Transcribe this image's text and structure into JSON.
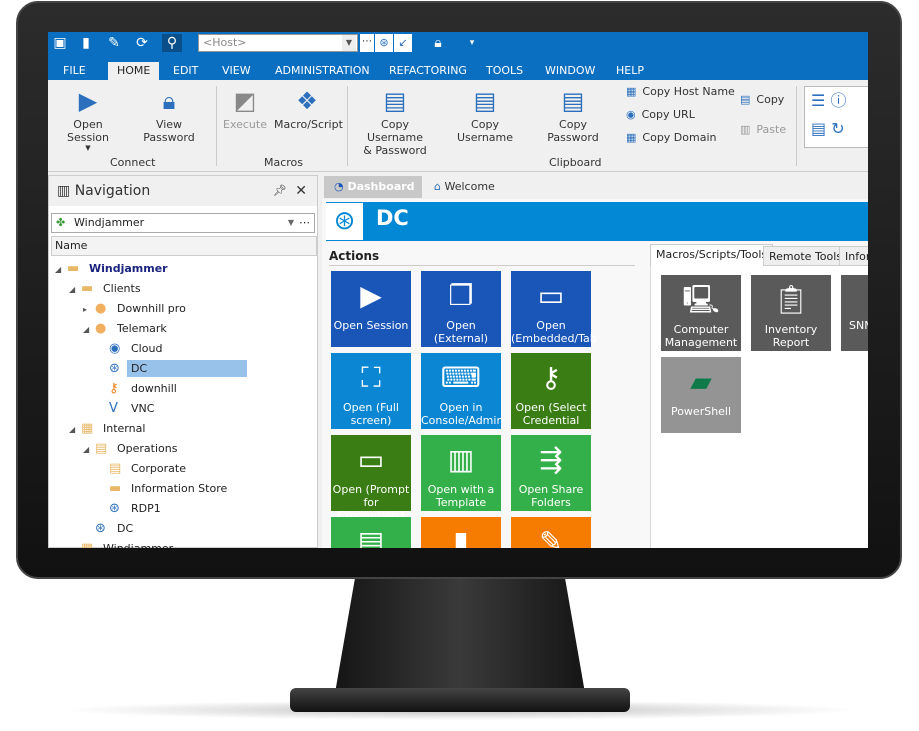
{
  "quick_toolbar": {
    "host_placeholder": "<Host>",
    "icons": [
      "monitor-icon",
      "document-icon",
      "pencil-icon",
      "refresh-icon",
      "search-icon",
      "rdp-icon",
      "arrow-icon",
      "lock-icon"
    ]
  },
  "menu_tabs": [
    "FILE",
    "HOME",
    "EDIT",
    "VIEW",
    "ADMINISTRATION",
    "REFACTORING",
    "TOOLS",
    "WINDOW",
    "HELP"
  ],
  "active_tab": "HOME",
  "ribbon": {
    "connect": {
      "label": "Connect",
      "open_session": "Open Session",
      "view_password": "View Password"
    },
    "macros": {
      "label": "Macros",
      "execute": "Execute",
      "macro_script": "Macro/Script"
    },
    "clipboard": {
      "label": "Clipboard",
      "copy_user_pass_1": "Copy Username",
      "copy_user_pass_2": "& Password",
      "copy_username": "Copy Username",
      "copy_password": "Copy Password",
      "copy_host_name": "Copy Host Name",
      "copy_url": "Copy URL",
      "copy_domain": "Copy Domain",
      "copy": "Copy",
      "paste": "Paste"
    }
  },
  "navigation": {
    "title": "Navigation",
    "vault": "Windjammer",
    "column": "Name",
    "tree": [
      {
        "label": "Windjammer",
        "icon": "folder-icon",
        "bold": true
      },
      {
        "label": "Clients",
        "icon": "folder-icon"
      },
      {
        "label": "Downhill pro",
        "icon": "user-icon"
      },
      {
        "label": "Telemark",
        "icon": "user-icon"
      },
      {
        "label": "Cloud",
        "icon": "globe-icon"
      },
      {
        "label": "DC",
        "icon": "rdp-icon",
        "selected": true
      },
      {
        "label": "downhill",
        "icon": "key-icon"
      },
      {
        "label": "VNC",
        "icon": "vnc-icon"
      },
      {
        "label": "Internal",
        "icon": "building-icon"
      },
      {
        "label": "Operations",
        "icon": "contact-folder-icon"
      },
      {
        "label": "Corporate",
        "icon": "contact-folder-icon"
      },
      {
        "label": "Information Store",
        "icon": "folder-icon"
      },
      {
        "label": "RDP1",
        "icon": "rdp-icon"
      },
      {
        "label": "DC",
        "icon": "rdp-icon"
      },
      {
        "label": "Windjammer",
        "icon": "building-icon"
      }
    ]
  },
  "doc_tabs": {
    "dashboard": "Dashboard",
    "welcome": "Welcome"
  },
  "entry": {
    "title": "DC"
  },
  "actions": {
    "title": "Actions",
    "tiles": [
      {
        "l1": "Open Session",
        "l2": "",
        "color": "#1a56b8"
      },
      {
        "l1": "Open",
        "l2": "(External)",
        "color": "#1a56b8"
      },
      {
        "l1": "Open",
        "l2": "(Embedded/Tab",
        "color": "#1a56b8"
      },
      {
        "l1": "Open (Full",
        "l2": "screen)",
        "color": "#0a86d2"
      },
      {
        "l1": "Open in",
        "l2": "Console/Admin",
        "color": "#0a86d2"
      },
      {
        "l1": "Open (Select",
        "l2": "Credential",
        "color": "#3a7d14"
      },
      {
        "l1": "Open (Prompt",
        "l2": "for Credentials)",
        "color": "#3a7d14"
      },
      {
        "l1": "Open with a",
        "l2": "Template",
        "color": "#34b04a"
      },
      {
        "l1": "Open Share",
        "l2": "Folders",
        "color": "#34b04a"
      },
      {
        "l1": "",
        "l2": "",
        "color": "#34b04a"
      },
      {
        "l1": "",
        "l2": "",
        "color": "#f57c00"
      },
      {
        "l1": "",
        "l2": "",
        "color": "#f57c00"
      }
    ]
  },
  "tools_panel": {
    "tabs": [
      "Macros/Scripts/Tools",
      "Remote Tools",
      "Infor"
    ],
    "tiles": [
      {
        "l1": "Computer",
        "l2": "Management"
      },
      {
        "l1": "Inventory",
        "l2": "Report"
      },
      {
        "l1": "SNM",
        "l2": ""
      },
      {
        "l1": "PowerShell",
        "l2": ""
      }
    ]
  }
}
